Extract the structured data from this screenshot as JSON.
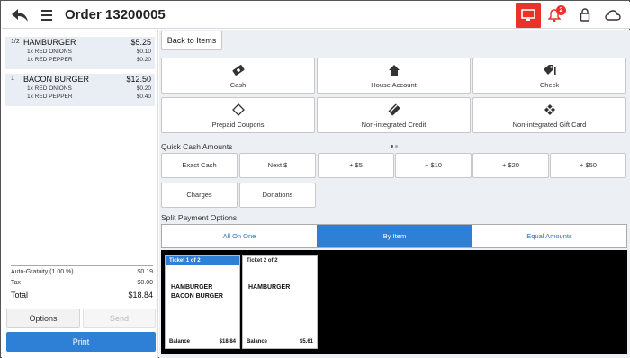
{
  "header": {
    "title": "Order 13200005",
    "notification_count": "2",
    "accent_color": "#e8322b"
  },
  "order": {
    "items": [
      {
        "qty": "1/2",
        "name": "HAMBURGER",
        "price": "$5.25",
        "modifiers": [
          {
            "name": "1x  RED ONIONS",
            "price": "$0.10"
          },
          {
            "name": "1x  RED PEPPER",
            "price": "$0.20"
          }
        ]
      },
      {
        "qty": "1",
        "name": "BACON BURGER",
        "price": "$12.50",
        "modifiers": [
          {
            "name": "1x  RED ONIONS",
            "price": "$0.20"
          },
          {
            "name": "1x  RED PEPPER",
            "price": "$0.40"
          }
        ]
      }
    ],
    "totals": {
      "gratuity_label": "Auto-Gratuity (1.00 %)",
      "gratuity_value": "$0.19",
      "tax_label": "Tax",
      "tax_value": "$0.00",
      "total_label": "Total",
      "total_value": "$18.84"
    },
    "options_label": "Options",
    "send_label": "Send",
    "print_label": "Print"
  },
  "payment": {
    "back_label": "Back to Items",
    "methods": [
      {
        "label": "Cash",
        "icon": "cash-icon"
      },
      {
        "label": "House Account",
        "icon": "house-icon"
      },
      {
        "label": "Check",
        "icon": "check-icon"
      },
      {
        "label": "Prepaid Coupons",
        "icon": "coupon-icon"
      },
      {
        "label": "Non-integrated Credit",
        "icon": "credit-card-icon"
      },
      {
        "label": "Non-integrated Gift Card",
        "icon": "gift-card-icon"
      }
    ],
    "quick_cash_title": "Quick Cash Amounts",
    "quick_cash": [
      "Exact Cash",
      "Next $",
      "+ $5",
      "+ $10",
      "+ $20",
      "+ $50"
    ],
    "extra_buttons": [
      "Charges",
      "Donations"
    ],
    "split_title": "Split Payment Options",
    "split_tabs": [
      "All On One",
      "By Item",
      "Equal Amounts"
    ],
    "active_split_tab": "By Item",
    "tickets": [
      {
        "header": "Ticket 1 of 2",
        "items": [
          "HAMBURGER",
          "BACON BURGER"
        ],
        "balance_label": "Balance",
        "balance": "$18.84",
        "selected": true
      },
      {
        "header": "Ticket 2 of 2",
        "items": [
          "HAMBURGER"
        ],
        "balance_label": "Balance",
        "balance": "$5.61",
        "selected": false
      }
    ]
  }
}
